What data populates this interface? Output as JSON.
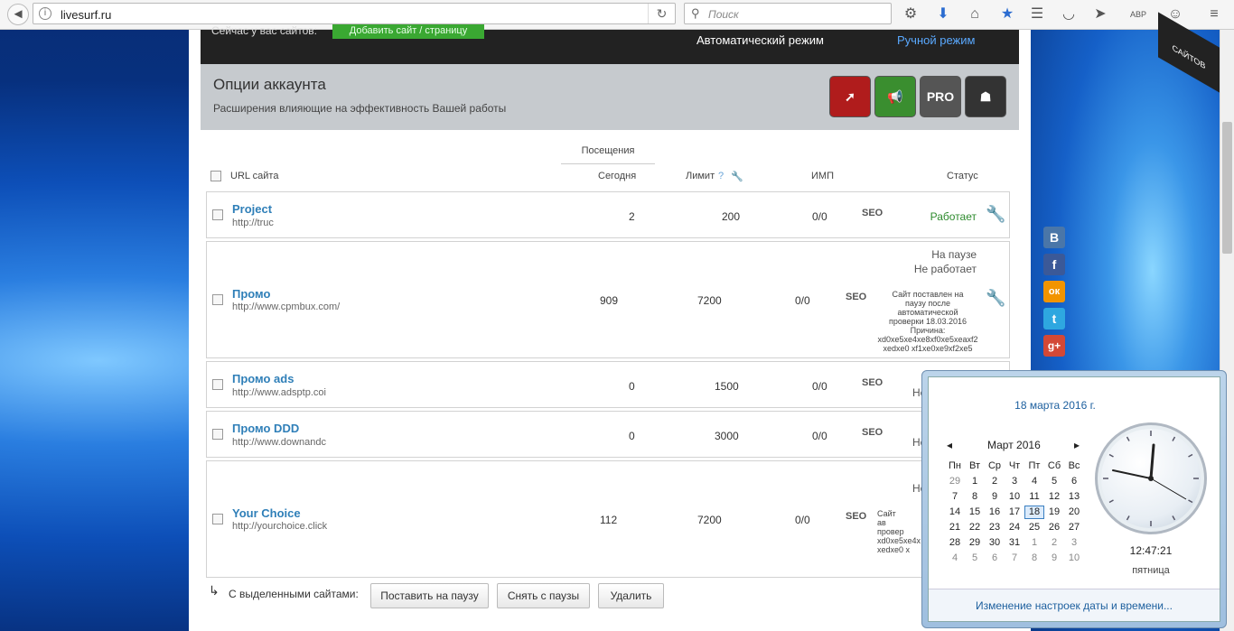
{
  "browser": {
    "url": "livesurf.ru",
    "search_placeholder": "Поиск",
    "lang_badge": "АВР"
  },
  "page": {
    "top_line": "Сейчас у вас сайтов:",
    "add_site_button": "Добавить сайт / страницу",
    "mode_auto": "Автоматический режим",
    "mode_manual": "Ручной режим",
    "options_title": "Опции аккаунта",
    "options_subtitle": "Расширения влияющие на эффективность Вашей работы",
    "option_badges": [
      "rocket-icon",
      "megaphone-icon",
      "PRO",
      "agent-icon"
    ],
    "visits_header": "Посещения",
    "columns": {
      "url": "URL сайта",
      "today": "Сегодня",
      "limit": "Лимит",
      "imp": "ИМП",
      "status": "Статус"
    },
    "rows": [
      {
        "name": "Project",
        "url": "http://truc",
        "today": "2",
        "limit": "200",
        "imp": "0/0",
        "status": "Работает"
      },
      {
        "name": "Промо",
        "url": "http://www.cpmbux.com/",
        "today": "909",
        "limit": "7200",
        "imp": "0/0",
        "status1": "На паузе",
        "status2": "Не работает",
        "reason": [
          "Сайт поставлен на",
          "паузу после",
          "автоматической",
          "проверки 18.03.2016",
          "Причина:",
          "xd0xe5xe4xe8xf0xe5xeaxf2",
          "xedxe0 xf1xe0xe9xf2xe5"
        ]
      },
      {
        "name": "Промо ads",
        "url": "http://www.adsptp.coi",
        "today": "0",
        "limit": "1500",
        "imp": "0/0",
        "status": "Не"
      },
      {
        "name": "Промо DDD",
        "url": "http://www.downandc",
        "today": "0",
        "limit": "3000",
        "imp": "0/0",
        "status": "Не"
      },
      {
        "name": "Your Choice",
        "url": "http://yourchoice.click",
        "today": "112",
        "limit": "7200",
        "imp": "0/0",
        "status": "Не",
        "reason": [
          "Сайт",
          "",
          "ав",
          "провер",
          "",
          "xd0xe5xe4x",
          "xedxe0 x"
        ]
      }
    ],
    "seo_label": "SEO",
    "bulk_label": "С выделенными сайтами:",
    "bulk_pause": "Поставить на паузу",
    "bulk_unpause": "Снять с паузы",
    "bulk_delete": "Удалить"
  },
  "ribbon": "САЙТОВ",
  "social": [
    "В",
    "f",
    "ок",
    "t",
    "g+"
  ],
  "clock_popup": {
    "date_long": "18 марта 2016 г.",
    "month": "Март 2016",
    "weekdays": [
      "Пн",
      "Вт",
      "Ср",
      "Чт",
      "Пт",
      "Сб",
      "Вс"
    ],
    "days": [
      [
        "29",
        "1",
        "2",
        "3",
        "4",
        "5",
        "6"
      ],
      [
        "7",
        "8",
        "9",
        "10",
        "11",
        "12",
        "13"
      ],
      [
        "14",
        "15",
        "16",
        "17",
        "18",
        "19",
        "20"
      ],
      [
        "21",
        "22",
        "23",
        "24",
        "25",
        "26",
        "27"
      ],
      [
        "28",
        "29",
        "30",
        "31",
        "1",
        "2",
        "3"
      ],
      [
        "4",
        "5",
        "6",
        "7",
        "8",
        "9",
        "10"
      ]
    ],
    "today": "18",
    "time": "12:47:21",
    "weekday": "пятница",
    "settings_link": "Изменение настроек даты и времени..."
  }
}
